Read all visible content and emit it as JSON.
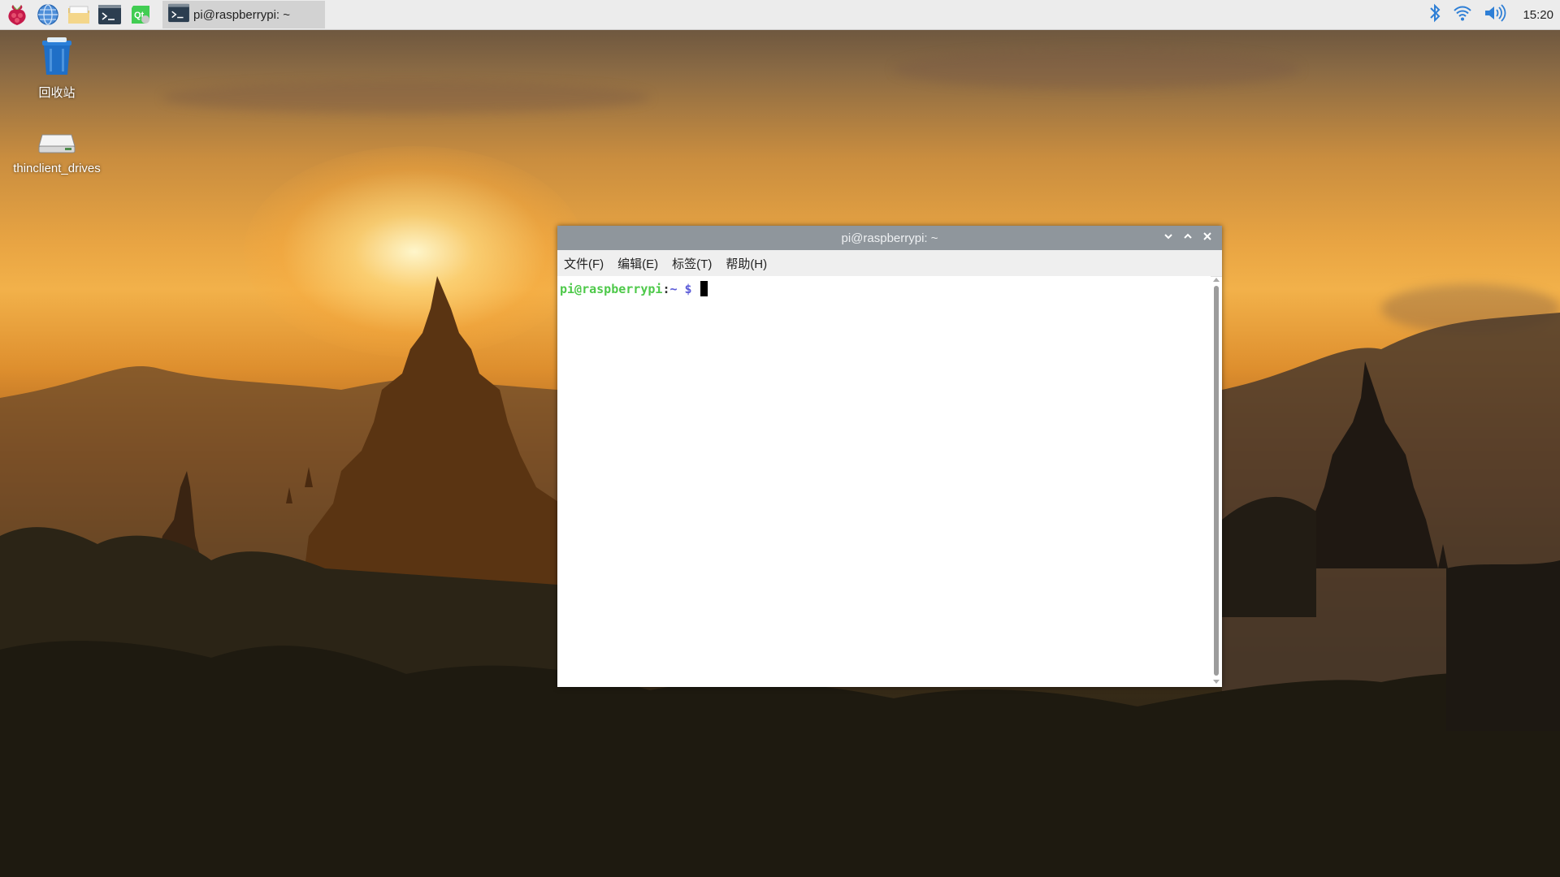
{
  "panel": {
    "launchers": [
      {
        "name": "raspberry-menu-icon"
      },
      {
        "name": "web-browser-icon"
      },
      {
        "name": "file-manager-icon"
      },
      {
        "name": "terminal-icon"
      },
      {
        "name": "qt-creator-icon"
      }
    ],
    "task": {
      "label": "pi@raspberrypi: ~",
      "icon": "terminal-icon"
    },
    "tray": {
      "bluetooth": "bluetooth-icon",
      "wifi": "wifi-icon",
      "volume": "volume-icon"
    },
    "clock": "15:20"
  },
  "desktop": {
    "icons": [
      {
        "label": "回收站",
        "icon": "trash-icon"
      },
      {
        "label": "thinclient_drives",
        "icon": "drive-icon"
      }
    ]
  },
  "terminal": {
    "title": "pi@raspberrypi: ~",
    "menus": [
      "文件(F)",
      "编辑(E)",
      "标签(T)",
      "帮助(H)"
    ],
    "prompt": {
      "user_host": "pi@raspberrypi",
      "sep": ":",
      "path": "~ $"
    }
  },
  "colors": {
    "panel_bg": "#ececec",
    "titlebar_bg": "#8f969c",
    "prompt_user": "#4ec94a",
    "prompt_path": "#5b5bd8"
  }
}
